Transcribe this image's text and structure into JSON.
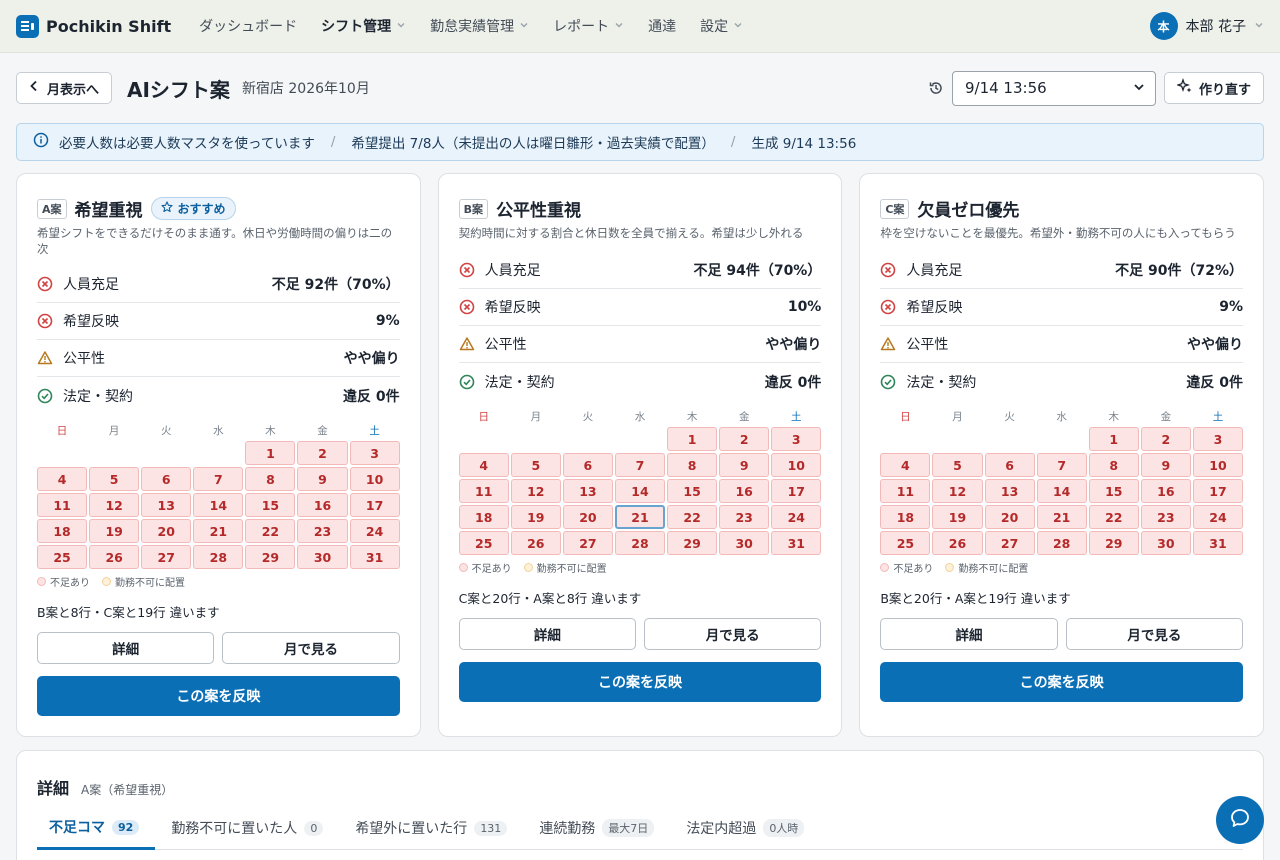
{
  "app": {
    "name": "Pochikin Shift"
  },
  "nav": {
    "items": [
      {
        "label": "ダッシュボード",
        "dropdown": false,
        "active": false
      },
      {
        "label": "シフト管理",
        "dropdown": true,
        "active": true
      },
      {
        "label": "勤怠実績管理",
        "dropdown": true,
        "active": false
      },
      {
        "label": "レポート",
        "dropdown": true,
        "active": false
      },
      {
        "label": "通達",
        "dropdown": false,
        "active": false
      },
      {
        "label": "設定",
        "dropdown": true,
        "active": false
      }
    ]
  },
  "user": {
    "avatar": "本",
    "name": "本部 花子"
  },
  "header": {
    "back_label": "月表示へ",
    "title": "AIシフト案",
    "subtitle": "新宿店 2026年10月",
    "version_select": "9/14 13:56",
    "redo_label": "作り直す"
  },
  "infobar": {
    "items": [
      "必要人数は必要人数マスタを使っています",
      "希望提出 7/8人（未提出の人は曜日雛形・過去実績で配置）",
      "生成 9/14 13:56"
    ]
  },
  "weekdays": [
    "日",
    "月",
    "火",
    "水",
    "木",
    "金",
    "土"
  ],
  "legend": {
    "shortage": "不足あり",
    "unavailable": "勤務不可に配置"
  },
  "plans": [
    {
      "tag": "A案",
      "title": "希望重視",
      "recommended": "おすすめ",
      "description": "希望シフトをできるだけそのまま通す。休日や労働時間の偏りは二の次",
      "metrics": [
        {
          "label": "人員充足",
          "value": "不足 92件（70%）",
          "status": "error"
        },
        {
          "label": "希望反映",
          "value": "9%",
          "status": "error"
        },
        {
          "label": "公平性",
          "value": "やや偏り",
          "status": "warning"
        },
        {
          "label": "法定・契約",
          "value": "違反 0件",
          "status": "ok"
        }
      ],
      "first_weekday": 4,
      "days": 31,
      "selected_day": null,
      "diff": "B案と8行・C案と19行 違います",
      "detail_label": "詳細",
      "month_label": "月で見る",
      "apply_label": "この案を反映"
    },
    {
      "tag": "B案",
      "title": "公平性重視",
      "recommended": null,
      "description": "契約時間に対する割合と休日数を全員で揃える。希望は少し外れる",
      "metrics": [
        {
          "label": "人員充足",
          "value": "不足 94件（70%）",
          "status": "error"
        },
        {
          "label": "希望反映",
          "value": "10%",
          "status": "error"
        },
        {
          "label": "公平性",
          "value": "やや偏り",
          "status": "warning"
        },
        {
          "label": "法定・契約",
          "value": "違反 0件",
          "status": "ok"
        }
      ],
      "first_weekday": 4,
      "days": 31,
      "selected_day": 21,
      "diff": "C案と20行・A案と8行 違います",
      "detail_label": "詳細",
      "month_label": "月で見る",
      "apply_label": "この案を反映"
    },
    {
      "tag": "C案",
      "title": "欠員ゼロ優先",
      "recommended": null,
      "description": "枠を空けないことを最優先。希望外・勤務不可の人にも入ってもらう",
      "metrics": [
        {
          "label": "人員充足",
          "value": "不足 90件（72%）",
          "status": "error"
        },
        {
          "label": "希望反映",
          "value": "9%",
          "status": "error"
        },
        {
          "label": "公平性",
          "value": "やや偏り",
          "status": "warning"
        },
        {
          "label": "法定・契約",
          "value": "違反 0件",
          "status": "ok"
        }
      ],
      "first_weekday": 4,
      "days": 31,
      "selected_day": null,
      "diff": "B案と20行・A案と19行 違います",
      "detail_label": "詳細",
      "month_label": "月で見る",
      "apply_label": "この案を反映"
    }
  ],
  "details": {
    "title": "詳細",
    "subtitle": "A案（希望重視）",
    "tabs": [
      {
        "label": "不足コマ",
        "count": "92",
        "active": true
      },
      {
        "label": "勤務不可に置いた人",
        "count": "0",
        "active": false
      },
      {
        "label": "希望外に置いた行",
        "count": "131",
        "active": false
      },
      {
        "label": "連続勤務",
        "count": "最大7日",
        "active": false
      },
      {
        "label": "法定内超過",
        "count": "0人時",
        "active": false
      }
    ]
  },
  "colors": {
    "primary": "#0b6fb5",
    "error": "#d14343",
    "warning": "#b7791f",
    "ok": "#2f855a",
    "shortage_bg": "#fde4e4"
  },
  "icons": {
    "chat": "chat-bubble-icon",
    "history": "history-icon",
    "redo": "sparkle-icon",
    "info": "info-icon"
  }
}
